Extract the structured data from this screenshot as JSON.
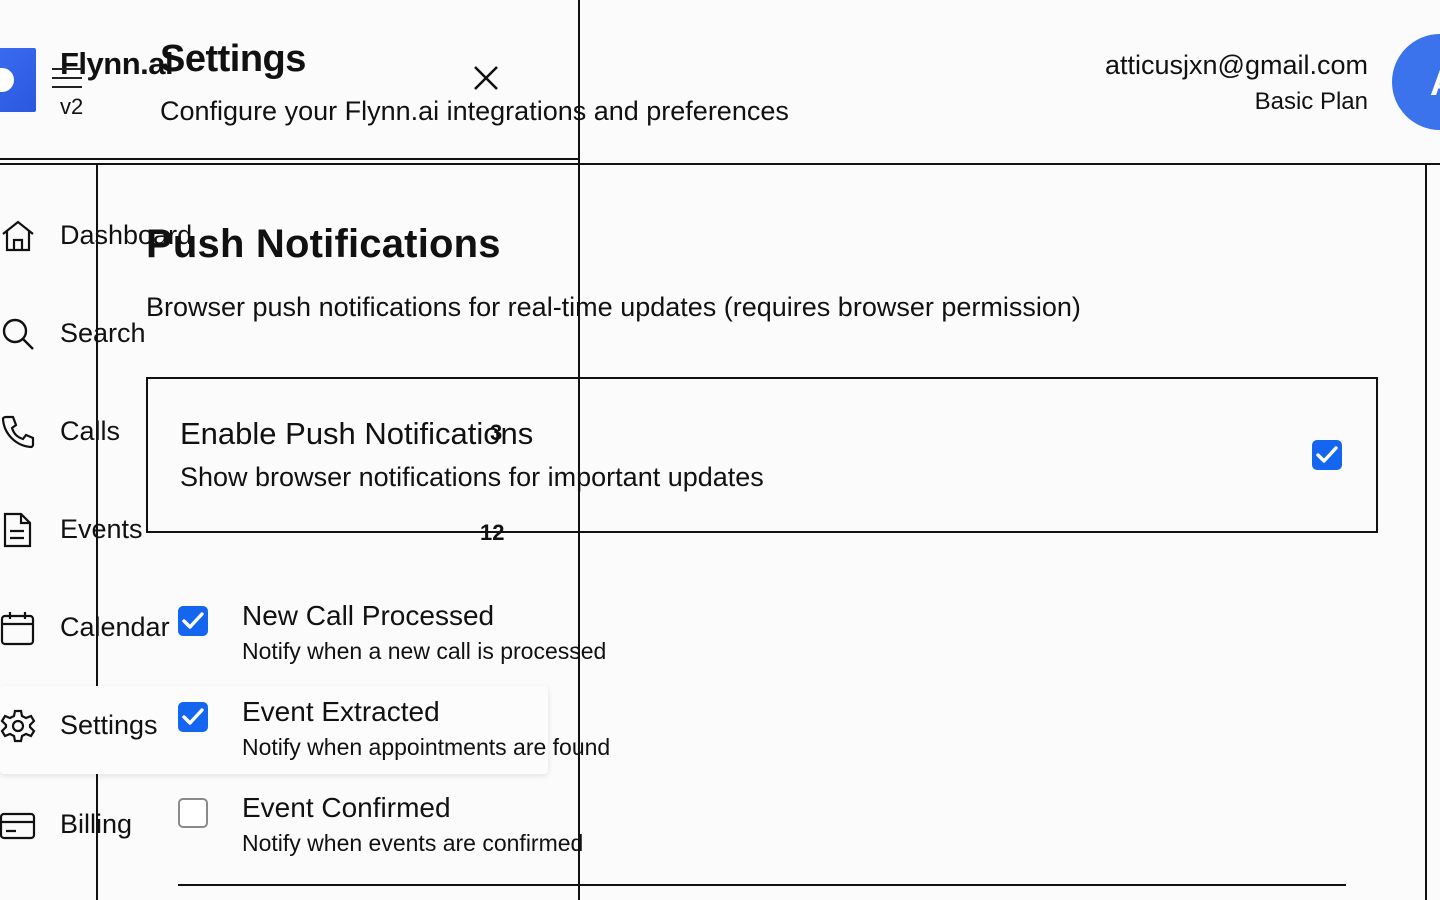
{
  "brand": {
    "name": "Flynn.ai",
    "version": "v2"
  },
  "header": {
    "title": "Settings",
    "subtitle": "Configure your Flynn.ai integrations and preferences"
  },
  "user": {
    "email": "atticusjxn@gmail.com",
    "plan": "Basic Plan",
    "avatar_initial": "A"
  },
  "sidebar": {
    "items": [
      {
        "label": "Dashboard",
        "icon": "home-icon"
      },
      {
        "label": "Search",
        "icon": "search-icon"
      },
      {
        "label": "Calls",
        "icon": "phone-icon",
        "badge": "3"
      },
      {
        "label": "Events",
        "icon": "document-icon",
        "badge": "12"
      },
      {
        "label": "Calendar",
        "icon": "calendar-icon"
      },
      {
        "label": "Settings",
        "icon": "gear-icon",
        "active": true
      },
      {
        "label": "Billing",
        "icon": "credit-card-icon"
      }
    ]
  },
  "push": {
    "title": "Push Notifications",
    "description": "Browser push notifications for real-time updates (requires browser permission)",
    "enable": {
      "title": "Enable Push Notifications",
      "description": "Show browser notifications for important updates",
      "checked": true
    },
    "options": [
      {
        "title": "New Call Processed",
        "description": "Notify when a new call is processed",
        "checked": true
      },
      {
        "title": "Event Extracted",
        "description": "Notify when appointments are found",
        "checked": true
      },
      {
        "title": "Event Confirmed",
        "description": "Notify when events are confirmed",
        "checked": false
      }
    ]
  },
  "colors": {
    "accent": "#1466f0",
    "avatar": "#3a73ec",
    "logo": "#2a58e0"
  }
}
